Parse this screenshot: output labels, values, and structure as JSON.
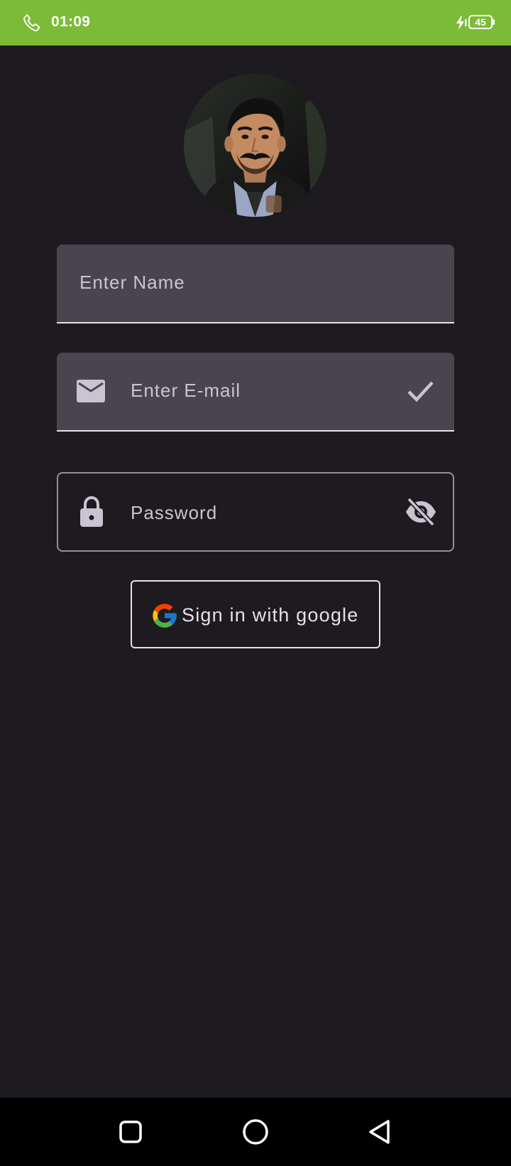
{
  "status_bar": {
    "time": "01:09",
    "battery_level": "45",
    "icons": [
      "phone-icon",
      "charging-icon",
      "battery-icon"
    ],
    "background_color": "#7cbb38"
  },
  "profile": {
    "avatar": "profile-photo"
  },
  "form": {
    "name_field": {
      "placeholder": "Enter Name",
      "value": ""
    },
    "email_field": {
      "placeholder": "Enter E-mail",
      "value": "",
      "leading_icon": "mail-icon",
      "trailing_icon": "check-icon"
    },
    "password_field": {
      "placeholder": "Password",
      "value": "",
      "leading_icon": "lock-icon",
      "trailing_icon": "eye-off-icon"
    }
  },
  "google_button": {
    "label": "Sign in with google",
    "icon": "google-logo-icon"
  },
  "nav_bar": {
    "buttons": [
      "recents-button",
      "home-button",
      "back-button"
    ]
  },
  "colors": {
    "background": "#1d1b20",
    "field_fill": "#49454f",
    "placeholder_text": "#cac4d0",
    "outline": "#938f99"
  }
}
